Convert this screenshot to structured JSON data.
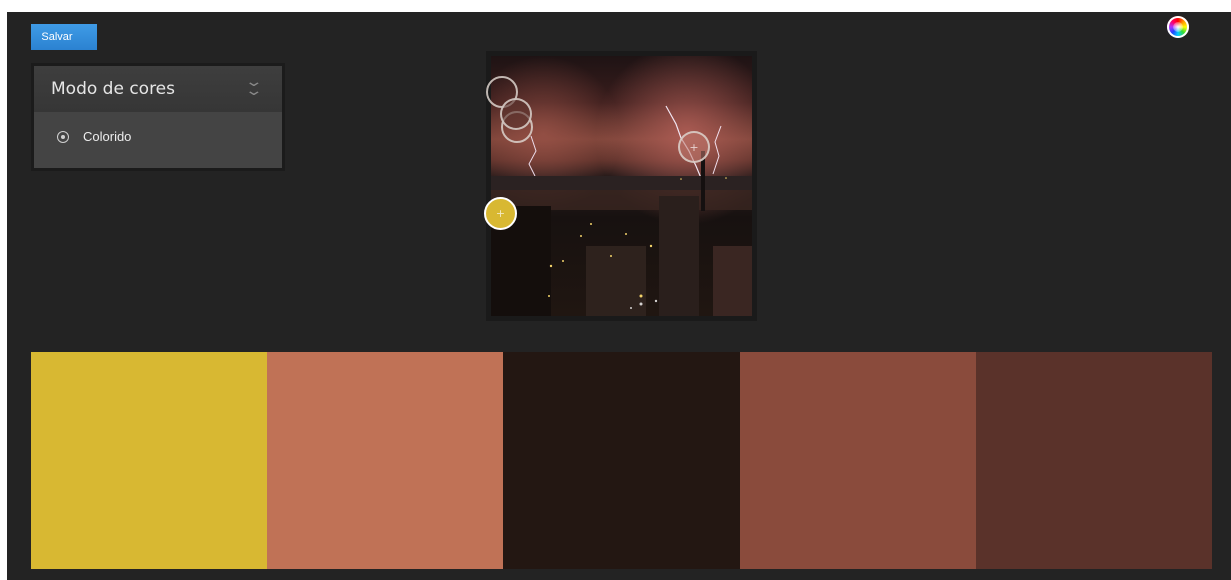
{
  "toolbar": {
    "save_label": "Salvar"
  },
  "color_mode_panel": {
    "title": "Modo de cores",
    "selected_option": "Colorido"
  },
  "palette": {
    "swatches": [
      {
        "color": "#D8B832"
      },
      {
        "color": "#C07256"
      },
      {
        "color": "#231712"
      },
      {
        "color": "#8A4B3C"
      },
      {
        "color": "#5A322A"
      }
    ]
  },
  "pickers": [
    {
      "color": "#2a1e1e"
    },
    {
      "color": "#5a3a34"
    },
    {
      "color": "#8a4b3c"
    },
    {
      "color": "#c07256"
    },
    {
      "color": "#D8B832"
    }
  ],
  "icons": {
    "color_wheel": "color-wheel-icon",
    "collapse": "double-chevron-down-icon",
    "radio": "radio-selected-icon"
  }
}
